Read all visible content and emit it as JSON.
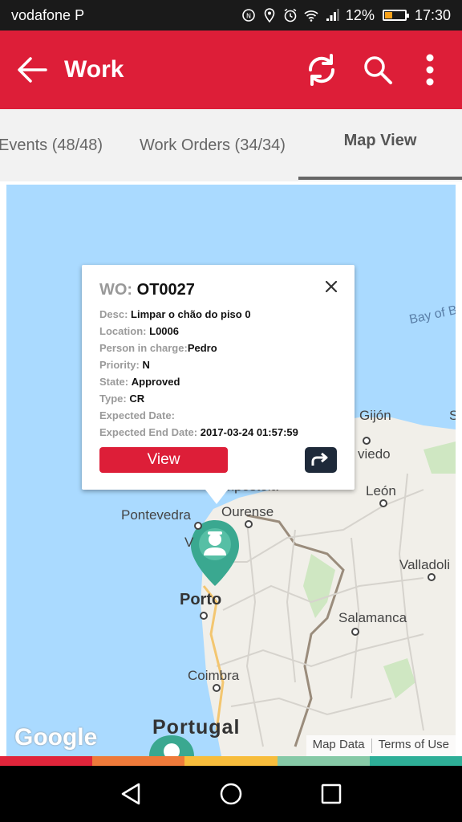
{
  "status_bar": {
    "carrier": "vodafone P",
    "battery": "12%",
    "time": "17:30",
    "battery_level": 0.12
  },
  "app_bar": {
    "title": "Work",
    "icons": [
      "back-arrow-icon",
      "refresh-icon",
      "search-icon",
      "more-vert-icon"
    ]
  },
  "tabs": [
    {
      "label": "Events (48/48)",
      "active": false
    },
    {
      "label": "Work Orders (34/34)",
      "active": false
    },
    {
      "label": "Map View",
      "active": true
    }
  ],
  "info_window": {
    "title_label": "WO:",
    "title_value": "OT0027",
    "rows": [
      {
        "label": "Desc:",
        "value": "Limpar o chão do piso 0"
      },
      {
        "label": "Location:",
        "value": "L0006"
      },
      {
        "label": "Person in charge:",
        "value": "Pedro"
      },
      {
        "label": "Priority:",
        "value": "N"
      },
      {
        "label": "State:",
        "value": "Approved"
      },
      {
        "label": "Type:",
        "value": "CR"
      },
      {
        "label": "Expected Date:",
        "value": ""
      },
      {
        "label": "Expected End Date:",
        "value": "2017-03-24 01:57:59"
      }
    ],
    "view_button": "View"
  },
  "map": {
    "labels": {
      "gijon": "Gijón",
      "oviedo": "viedo",
      "compostela": "mpostela",
      "leon": "León",
      "pontevedra": "Pontevedra",
      "ourense": "Ourense",
      "valladolid": "Valladoli",
      "porto": "Porto",
      "salamanca": "Salamanca",
      "coimbra": "Coimbra",
      "portugal": "Portugal",
      "bay": "Bay of B",
      "vigo": "V",
      "s": "S"
    },
    "google": "Google",
    "map_data": "Map Data",
    "terms": "Terms of Use"
  },
  "colors": {
    "accent": "#dd1e38",
    "marker": "#3aa890",
    "strip": [
      "#e0253b",
      "#ee7a3a",
      "#f7bd3c",
      "#86c9a6",
      "#2eae97"
    ]
  }
}
